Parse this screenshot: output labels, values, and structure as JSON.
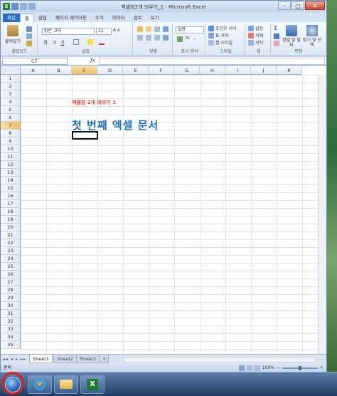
{
  "window": {
    "title": "엑셀창2개 띄우기_1 - Microsoft Excel"
  },
  "quick_access": [
    "excel-logo",
    "save-icon",
    "undo-icon",
    "redo-icon"
  ],
  "tabs": [
    {
      "label": "파일",
      "key": "F"
    },
    {
      "label": "홈",
      "key": "H"
    },
    {
      "label": "삽입",
      "key": "N"
    },
    {
      "label": "페이지 레이아웃",
      "key": "P"
    },
    {
      "label": "수식",
      "key": "M"
    },
    {
      "label": "데이터",
      "key": "A"
    },
    {
      "label": "검토",
      "key": "R"
    },
    {
      "label": "보기",
      "key": "W"
    }
  ],
  "ribbon": {
    "clipboard": {
      "paste": "붙여넣기",
      "label": "클립보드"
    },
    "font": {
      "name": "맑은 고딕",
      "size": "11",
      "label": "글꼴"
    },
    "alignment": {
      "label": "맞춤"
    },
    "number": {
      "format": "일반",
      "label": "표시 형식"
    },
    "styles": {
      "conditional": "조건부 서식",
      "table": "표 서식",
      "cell": "셀 스타일",
      "label": "스타일"
    },
    "cells": {
      "insert": "삽입",
      "delete": "삭제",
      "format": "서식",
      "label": "셀"
    },
    "editing": {
      "sort": "정렬 및 필터",
      "find": "찾기 및 선택",
      "label": "편집"
    }
  },
  "formula_bar": {
    "name_box": "C7",
    "fx": "fx",
    "value": ""
  },
  "columns": [
    "A",
    "B",
    "C",
    "D",
    "E",
    "F",
    "G",
    "H",
    "I",
    "J",
    "K"
  ],
  "selected_column": "C",
  "rows": [
    "1",
    "2",
    "3",
    "4",
    "5",
    "6",
    "7",
    "8",
    "9",
    "10",
    "11",
    "12",
    "13",
    "14",
    "15",
    "16",
    "17",
    "18",
    "19",
    "20",
    "21",
    "22",
    "23",
    "24",
    "25",
    "26",
    "27",
    "28",
    "29",
    "30",
    "31",
    "32",
    "33",
    "34",
    "35"
  ],
  "selected_row": "7",
  "cells": {
    "C4": "엑셀창 2개 띄우기 1",
    "C6": "첫 번째 엑셀 문서"
  },
  "sheet_tabs": [
    "Sheet1",
    "Sheet2",
    "Sheet3"
  ],
  "status": {
    "ready": "준비",
    "zoom": "100%"
  },
  "colors": {
    "accent_red": "#e23b2e",
    "title_blue": "#1f6fb8",
    "highlight": "#e0201a"
  }
}
